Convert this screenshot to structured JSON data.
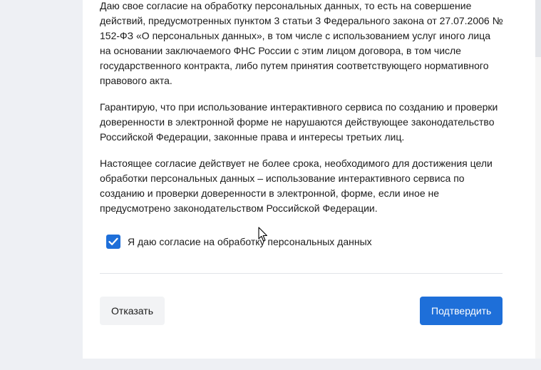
{
  "consent_text": {
    "paragraph_1": "Даю свое согласие на обработку персональных данных, то есть на совершение действий, предусмотренных пунктом 3 статьи 3 Федерального закона от 27.07.2006 № 152-ФЗ «О персональных данных», в том числе с использованием услуг иного лица на основании заключаемого ФНС России с этим лицом договора, в том числе государственного контракта, либо путем принятия соответствующего нормативного правового акта.",
    "paragraph_2": "Гарантирую, что при использование интерактивного сервиса по созданию и проверки доверенности в электронной форме не нарушаются действующее законодательство Российской Федерации, законные права и интересы третьих лиц.",
    "paragraph_3": "Настоящее согласие действует не более срока, необходимого для достижения цели обработки персональных данных – использование интерактивного сервиса по созданию и проверки доверенности в электронной, форме, если иное не предусмотрено законодательством Российской Федерации."
  },
  "consent_checkbox": {
    "label": "Я даю согласие на обработку персональных данных",
    "checked": true,
    "icon": "check-icon"
  },
  "actions": {
    "cancel_label": "Отказать",
    "confirm_label": "Подтвердить"
  },
  "colors": {
    "accent": "#1e6fd9",
    "text": "#1b1b1b",
    "secondary_button_bg": "#f2f3f5"
  }
}
